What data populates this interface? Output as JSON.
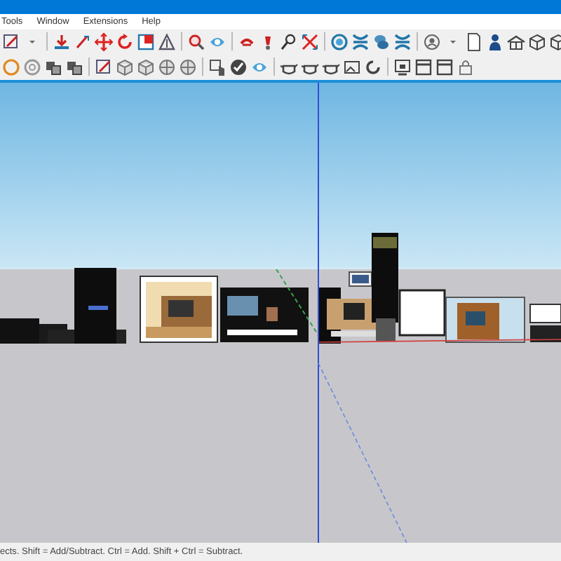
{
  "menu": [
    {
      "label": "Tools"
    },
    {
      "label": "Window"
    },
    {
      "label": "Extensions"
    },
    {
      "label": "Help"
    }
  ],
  "status_bar": {
    "text": "ects. Shift = Add/Subtract. Ctrl = Add. Shift + Ctrl = Subtract."
  }
}
